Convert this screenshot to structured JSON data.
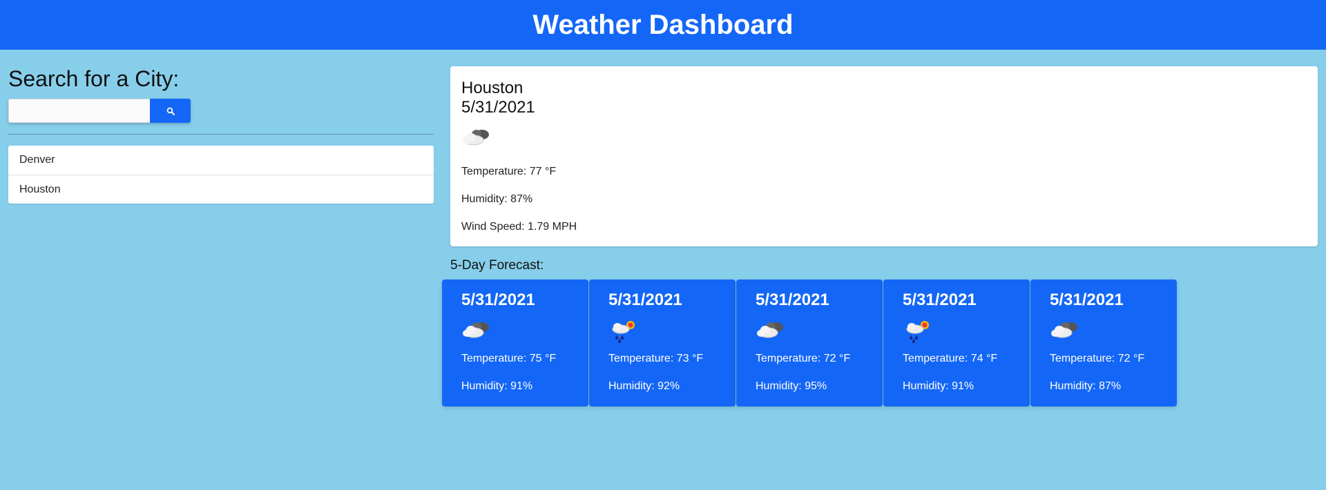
{
  "header": {
    "title": "Weather Dashboard"
  },
  "search": {
    "heading": "Search for a City:",
    "input_value": "",
    "button_icon": "search-icon"
  },
  "history": [
    "Denver",
    "Houston"
  ],
  "current": {
    "city": "Houston",
    "date": "5/31/2021",
    "icon": "cloudy-icon",
    "temperature": "Temperature: 77 °F",
    "humidity": "Humidity: 87%",
    "wind": "Wind Speed: 1.79 MPH"
  },
  "forecast": {
    "heading": "5-Day Forecast:",
    "days": [
      {
        "date": "5/31/2021",
        "icon": "cloudy-icon",
        "temperature": "Temperature: 75 °F",
        "humidity": "Humidity: 91%"
      },
      {
        "date": "5/31/2021",
        "icon": "rain-sun-icon",
        "temperature": "Temperature: 73 °F",
        "humidity": "Humidity: 92%"
      },
      {
        "date": "5/31/2021",
        "icon": "cloudy-icon",
        "temperature": "Temperature: 72 °F",
        "humidity": "Humidity: 95%"
      },
      {
        "date": "5/31/2021",
        "icon": "rain-sun-icon",
        "temperature": "Temperature: 74 °F",
        "humidity": "Humidity: 91%"
      },
      {
        "date": "5/31/2021",
        "icon": "cloudy-icon",
        "temperature": "Temperature: 72 °F",
        "humidity": "Humidity: 87%"
      }
    ]
  },
  "colors": {
    "accent": "#1467f6",
    "background": "#87ceeb"
  }
}
